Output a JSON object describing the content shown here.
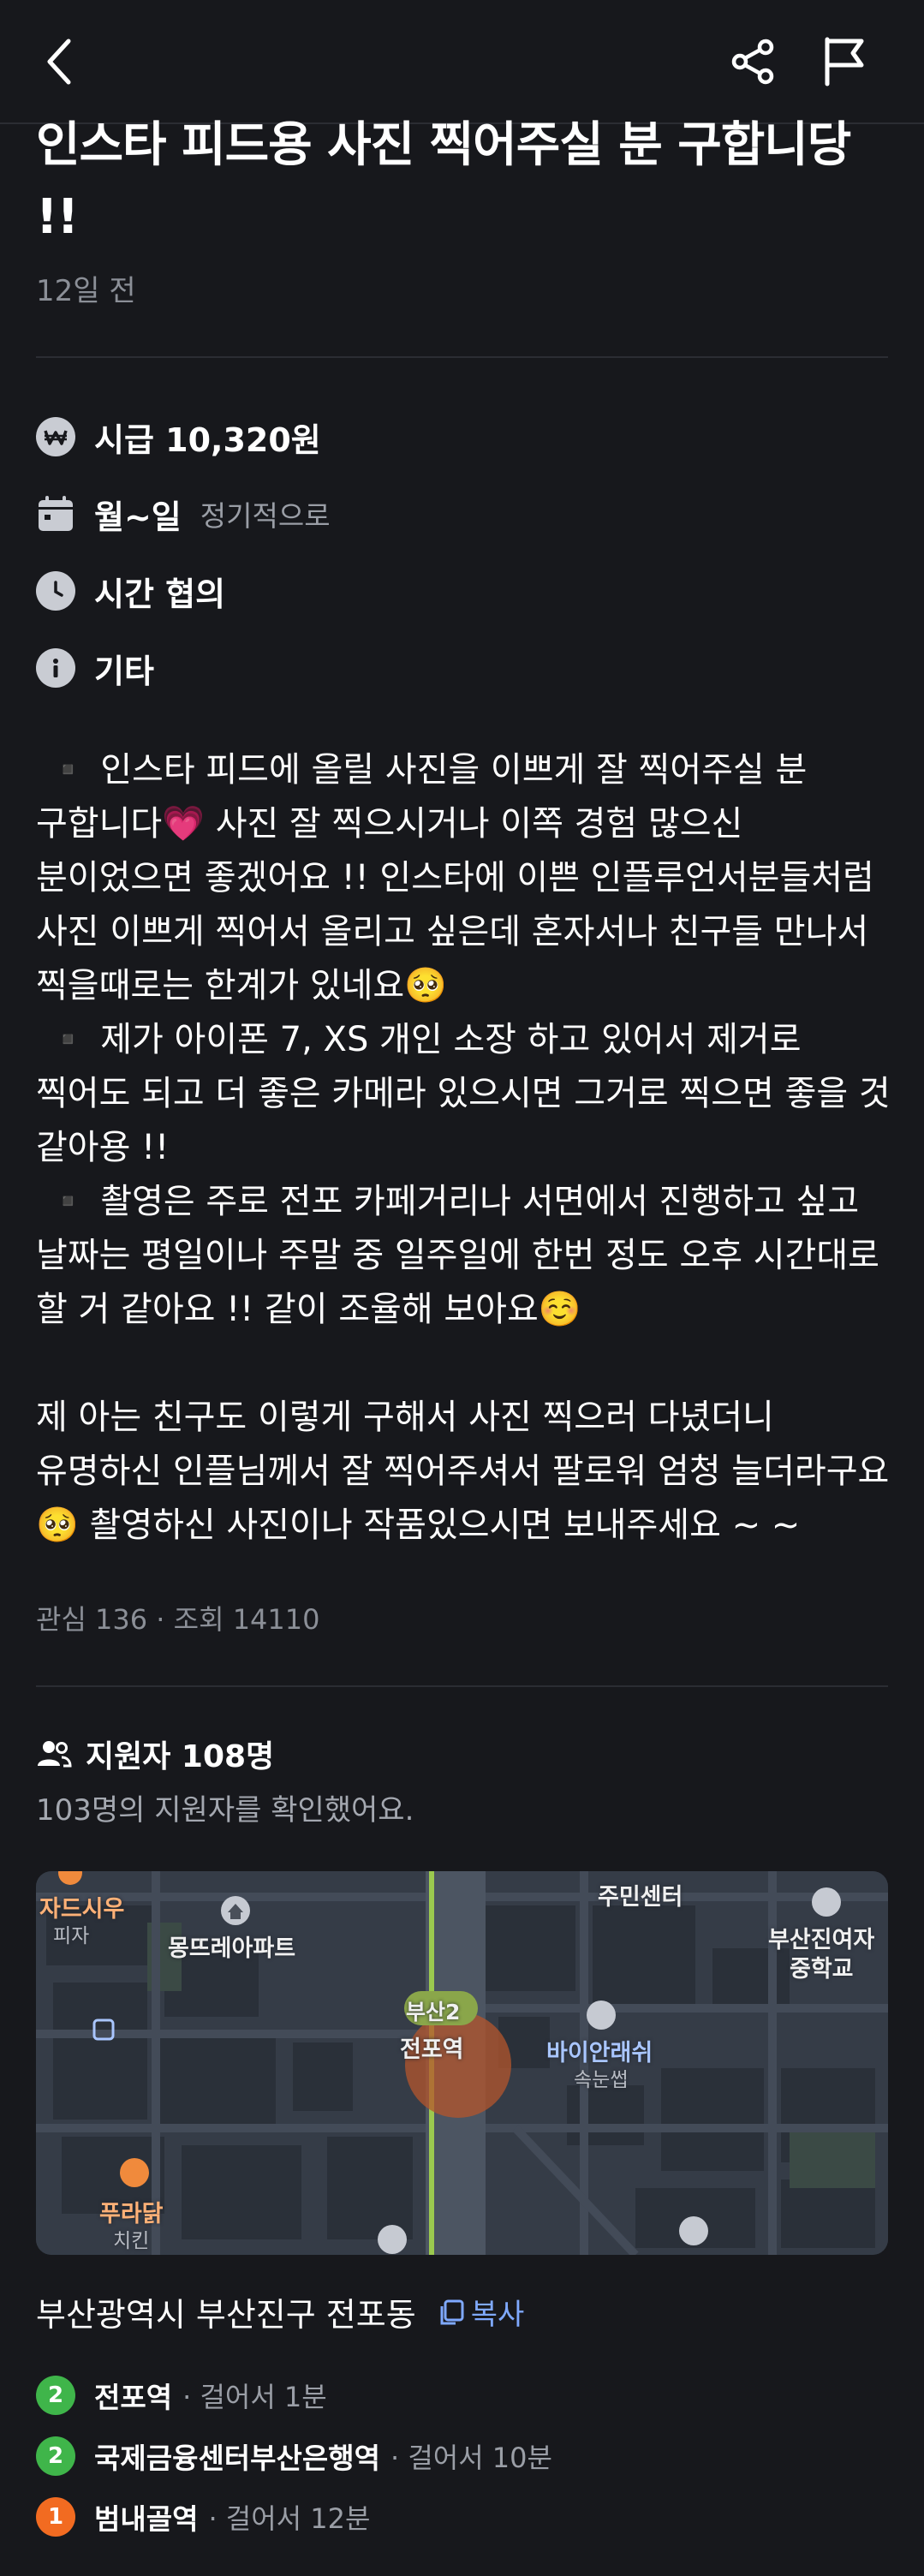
{
  "post": {
    "title": "인스타 피드용 사진 찍어주실 분 구합니당 !!",
    "posted_ago": "12일 전"
  },
  "info": {
    "wage": "시급 10,320원",
    "days": "월~일",
    "days_note": "정기적으로",
    "time": "시간 협의",
    "etc": "기타"
  },
  "description": " ▪️ 인스타 피드에 올릴 사진을 이쁘게 잘 찍어주실 분 구합니다💗 사진 잘 찍으시거나 이쪽 경험 많으신 분이었으면 좋겠어요 !! 인스타에 이쁜 인플루언서분들처럼 사진 이쁘게 찍어서 올리고 싶은데 혼자서나 친구들 만나서 찍을때로는 한계가 있네요🥺\n ▪️ 제가 아이폰 7, XS 개인 소장 하고 있어서 제거로 찍어도 되고 더 좋은 카메라 있으시면 그거로 찍으면 좋을 것 같아용 !!\n ▪️ 촬영은 주로 전포 카페거리나 서면에서 진행하고 싶고 날짜는 평일이나 주말 중 일주일에 한번 정도 오후 시간대로 할 거 같아요 !! 같이 조율해 보아요☺️\n\n제 아는 친구도 이렇게 구해서 사진 찍으러 다녔더니 유명하신 인플님께서 잘 찍어주셔서 팔로워 엄청 늘더라구요🥺 촬영하신 사진이나 작품있으시면 보내주세요 ~ ~",
  "stats": "관심 136 · 조회 14110",
  "applicants": {
    "title": "지원자 108명",
    "checked": "103명의 지원자를 확인했어요."
  },
  "map": {
    "labels": {
      "cafe": "자드시우",
      "cafe_type": "피자",
      "apartment": "몽뜨레아파트",
      "center": "주민센터",
      "school_line1": "부산진여자",
      "school_line2": "중학교",
      "line_badge": "부산2",
      "station": "전포역",
      "shop": "바이안래쉬",
      "shop_type": "속눈썹",
      "chicken": "푸라닭",
      "chicken_type": "치킨"
    }
  },
  "location": {
    "address": "부산광역시 부산진구 전포동",
    "copy_label": "복사"
  },
  "stations": [
    {
      "line": "2",
      "color": "#3fb54a",
      "name": "전포역",
      "distance": "· 걸어서 1분"
    },
    {
      "line": "2",
      "color": "#3fb54a",
      "name": "국제금융센터부산은행역",
      "distance": "· 걸어서 10분"
    },
    {
      "line": "1",
      "color": "#f26b21",
      "name": "범내골역",
      "distance": "· 걸어서 12분"
    }
  ],
  "colors": {
    "background": "#17181c",
    "muted_text": "#8b8f97",
    "link_blue": "#7fa9ff"
  }
}
